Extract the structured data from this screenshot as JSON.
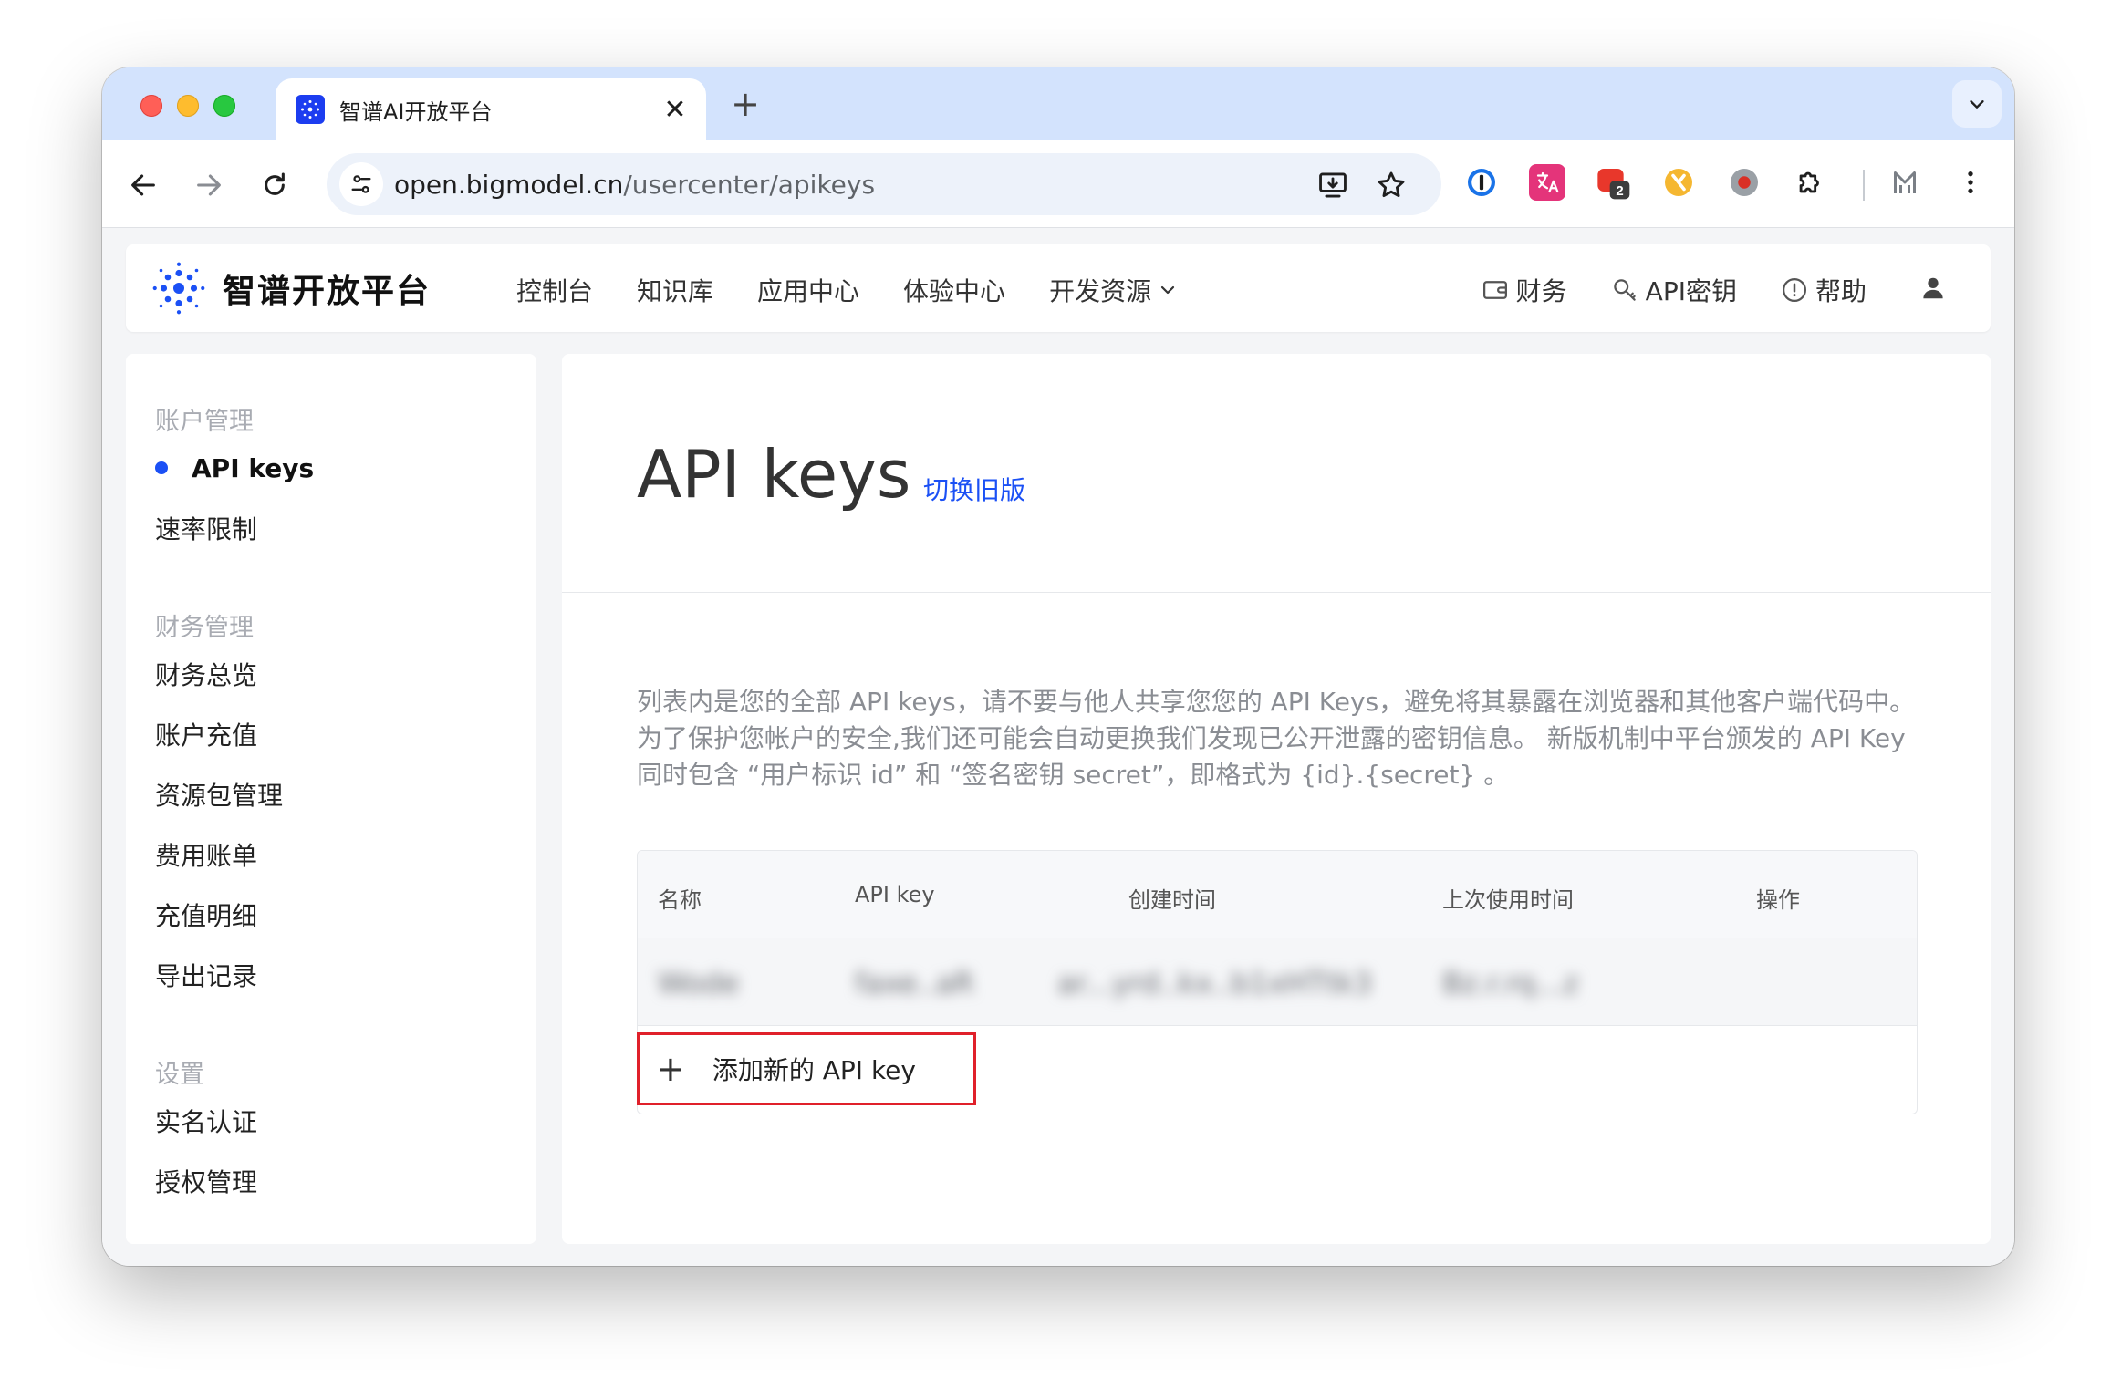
{
  "browser": {
    "tab": {
      "title": "智谱AI开放平台"
    },
    "url": {
      "host": "open.bigmodel.cn",
      "path": "/usercenter/apikeys"
    },
    "extensions": {
      "badge_count": "2"
    }
  },
  "site": {
    "logo_text": "智谱开放平台",
    "nav": [
      "控制台",
      "知识库",
      "应用中心",
      "体验中心",
      "开发资源"
    ],
    "nav_right": {
      "finance": "财务",
      "api_keys": "API密钥",
      "help": "帮助"
    }
  },
  "sidebar": {
    "section_account": "账户管理",
    "account_items": [
      "API keys",
      "速率限制"
    ],
    "section_finance": "财务管理",
    "finance_items": [
      "财务总览",
      "账户充值",
      "资源包管理",
      "费用账单",
      "充值明细",
      "导出记录"
    ],
    "section_settings": "设置",
    "settings_items": [
      "实名认证",
      "授权管理"
    ]
  },
  "main": {
    "title": "API keys",
    "switch_link": "切换旧版",
    "description": [
      "列表内是您的全部 API keys，请不要与他人共享您您的 API Keys，避免将其暴露在浏览器和其他客户端代码中。",
      "为了保护您帐户的安全,我们还可能会自动更换我们发现已公开泄露的密钥信息。 新版机制中平台颁发的 API Key",
      "同时包含 “用户标识 id” 和 “签名密钥 secret”，即格式为 {id}.{secret} 。"
    ],
    "table": {
      "headers": [
        "名称",
        "API key",
        "创建时间",
        "上次使用时间",
        "操作"
      ],
      "rows": [
        {
          "name": "Wode",
          "key": "faxe..aR",
          "secret": "ar...yrd..kx..b1xHTtk3",
          "created": "Bz.r.rq...z"
        }
      ]
    },
    "add_button": "添加新的 API key"
  },
  "colors": {
    "accent": "#1b50f5",
    "highlight_border": "#e0202a",
    "tab_strip": "#d3e3fd"
  }
}
